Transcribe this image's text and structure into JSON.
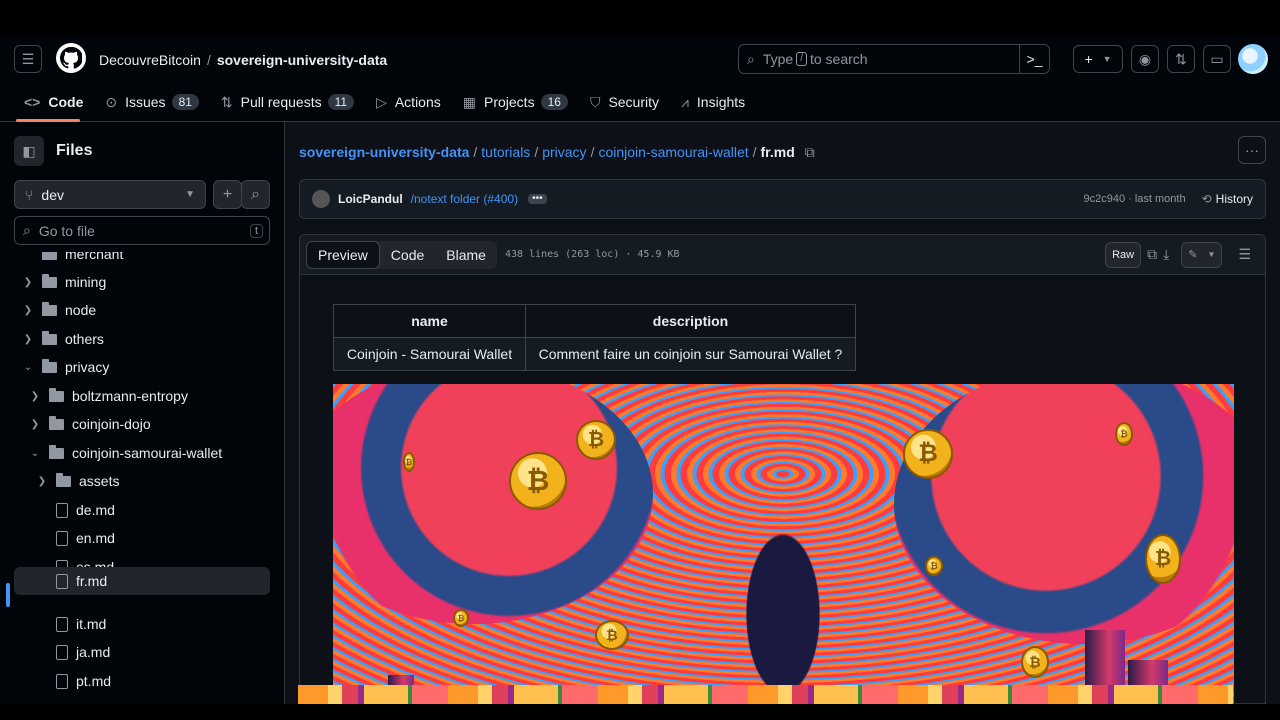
{
  "header": {
    "owner": "DecouvreBitcoin",
    "separator": "/",
    "repo": "sovereign-university-data",
    "search_prefix": "Type",
    "search_key": "/",
    "search_suffix": "to search",
    "plus_label": "+"
  },
  "tabs": [
    {
      "label": "Code",
      "icon": "code-icon"
    },
    {
      "label": "Issues",
      "count": "81",
      "icon": "issue-icon"
    },
    {
      "label": "Pull requests",
      "count": "11",
      "icon": "pull-request-icon"
    },
    {
      "label": "Actions",
      "icon": "play-icon"
    },
    {
      "label": "Projects",
      "count": "16",
      "icon": "table-icon"
    },
    {
      "label": "Security",
      "icon": "shield-icon"
    },
    {
      "label": "Insights",
      "icon": "graph-icon"
    }
  ],
  "sidebar": {
    "title": "Files",
    "branch": "dev",
    "goto_placeholder": "Go to file",
    "goto_key": "t",
    "tree": [
      {
        "label": "merchant",
        "type": "folder",
        "expanded": false
      },
      {
        "label": "mining",
        "type": "folder",
        "expanded": false
      },
      {
        "label": "node",
        "type": "folder",
        "expanded": false
      },
      {
        "label": "others",
        "type": "folder",
        "expanded": false
      },
      {
        "label": "privacy",
        "type": "folder",
        "expanded": true
      },
      {
        "label": "boltzmann-entropy",
        "type": "folder",
        "expanded": false
      },
      {
        "label": "coinjoin-dojo",
        "type": "folder",
        "expanded": false
      },
      {
        "label": "coinjoin-samourai-wallet",
        "type": "folder",
        "expanded": true
      },
      {
        "label": "assets",
        "type": "folder",
        "expanded": false
      },
      {
        "label": "de.md",
        "type": "file"
      },
      {
        "label": "en.md",
        "type": "file"
      },
      {
        "label": "es.md",
        "type": "file"
      },
      {
        "label": "fr.md",
        "type": "file",
        "selected": true
      },
      {
        "label": "it.md",
        "type": "file"
      },
      {
        "label": "ja.md",
        "type": "file"
      },
      {
        "label": "pt.md",
        "type": "file"
      }
    ]
  },
  "breadcrumb": {
    "parts": [
      "sovereign-university-data",
      "tutorials",
      "privacy",
      "coinjoin-samourai-wallet"
    ],
    "current": "fr.md",
    "sep": "/"
  },
  "commit": {
    "author": "LoicPandul",
    "message": "/notext folder (#400)",
    "dots": "•••",
    "sha": "9c2c940 · last month",
    "history": "History"
  },
  "file": {
    "tab_preview": "Preview",
    "tab_code": "Code",
    "tab_blame": "Blame",
    "meta": "438 lines (263 loc) · 45.9 KB",
    "raw": "Raw"
  },
  "table": {
    "headers": [
      "name",
      "description"
    ],
    "rows": [
      [
        "Coinjoin - Samourai Wallet",
        "Comment faire un coinjoin sur Samourai Wallet ?"
      ]
    ]
  },
  "coin_symbol": "₿",
  "colors": {
    "accent": "#4493f8",
    "tab_underline": "#f78166"
  }
}
